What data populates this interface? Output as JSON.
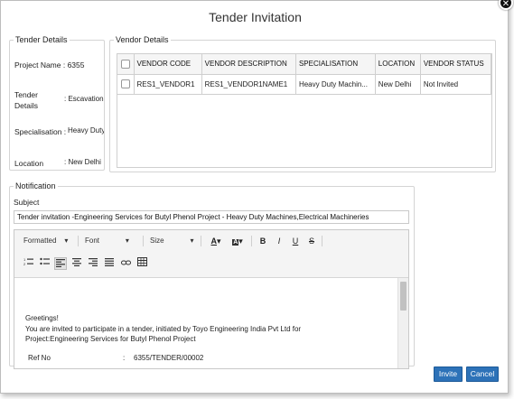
{
  "dialog": {
    "title": "Tender Invitation",
    "close_glyph": "✕"
  },
  "tender_details": {
    "legend": "Tender Details",
    "project_label": "Project Name : 6355",
    "tender_label": "Tender Details",
    "tender_value": ": Escavation Wo",
    "specialisation_label": "Specialisation :",
    "specialisation_value": "Heavy Duty M",
    "location_label": "Location",
    "location_value": ": New Delhi"
  },
  "vendor_details": {
    "legend": "Vendor Details",
    "columns": [
      "VENDOR CODE",
      "VENDOR DESCRIPTION",
      "SPECIALISATION",
      "LOCATION",
      "VENDOR STATUS"
    ],
    "rows": [
      {
        "code": "RES1_VENDOR1",
        "description": "RES1_VENDOR1NAME1",
        "specialisation": "Heavy Duty Machin...",
        "location": "New Delhi",
        "status": "Not Invited"
      }
    ]
  },
  "notification": {
    "legend": "Notification",
    "subject_label": "Subject",
    "subject_value": "Tender invitation -Engineering Services for Butyl Phenol Project - Heavy Duty Machines,Electrical Machineries",
    "toolbar": {
      "format": "Formatted",
      "font": "Font",
      "size": "Size",
      "text_color_icon": "text-color-icon",
      "bg_color_icon": "background-color-icon",
      "bold": "B",
      "italic": "I",
      "underline": "U",
      "strike": "S"
    },
    "body": {
      "greeting": "Greetings!",
      "line1": "You are invited to participate in a tender, initiated by Toyo Engineering India Pvt Ltd for",
      "line2": "Project:Engineering Services for Butyl Phenol Project",
      "ref_label": "Ref No",
      "ref_sep": ":",
      "ref_value": "6355/TENDER/00002"
    }
  },
  "actions": {
    "invite": "Invite",
    "cancel": "Cancel"
  },
  "colors": {
    "button": "#2d72b8",
    "border": "#d4d4d4"
  }
}
